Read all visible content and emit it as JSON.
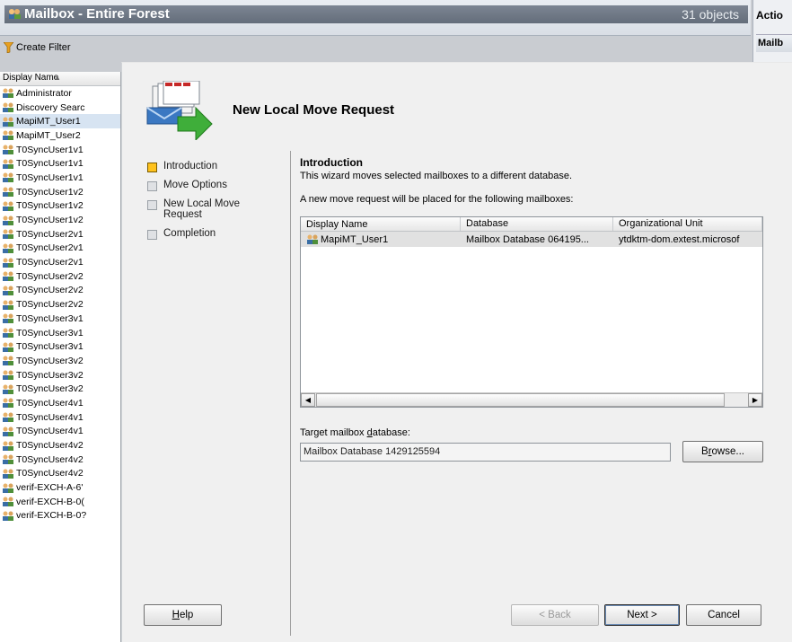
{
  "console": {
    "title": "Mailbox - Entire Forest",
    "object_count": "31 objects",
    "create_filter": "Create Filter",
    "actions_title": "Actio",
    "actions_section": "Mailb"
  },
  "list": {
    "column_header": "Display Name",
    "rows": [
      "Administrator",
      "Discovery Searc",
      "MapiMT_User1",
      "MapiMT_User2",
      "T0SyncUser1v1",
      "T0SyncUser1v1",
      "T0SyncUser1v1",
      "T0SyncUser1v2",
      "T0SyncUser1v2",
      "T0SyncUser1v2",
      "T0SyncUser2v1",
      "T0SyncUser2v1",
      "T0SyncUser2v1",
      "T0SyncUser2v2",
      "T0SyncUser2v2",
      "T0SyncUser2v2",
      "T0SyncUser3v1",
      "T0SyncUser3v1",
      "T0SyncUser3v1",
      "T0SyncUser3v2",
      "T0SyncUser3v2",
      "T0SyncUser3v2",
      "T0SyncUser4v1",
      "T0SyncUser4v1",
      "T0SyncUser4v1",
      "T0SyncUser4v2",
      "T0SyncUser4v2",
      "T0SyncUser4v2",
      "verif-EXCH-A-6'",
      "verif-EXCH-B-0(",
      "verif-EXCH-B-0?"
    ],
    "selected_index": 2
  },
  "wizard": {
    "title": "New Local Move Request",
    "steps": [
      "Introduction",
      "Move Options",
      "New Local Move Request",
      "Completion"
    ],
    "active_step": 0,
    "heading": "Introduction",
    "description": "This wizard moves selected mailboxes to a different database.",
    "list_label": "A new move request will be placed for the following mailboxes:",
    "grid": {
      "columns": [
        "Display Name",
        "Database",
        "Organizational Unit"
      ],
      "rows": [
        [
          "MapiMT_User1",
          "Mailbox Database 064195...",
          "ytdktm-dom.extest.microsof"
        ]
      ]
    },
    "target_label": "Target mailbox database:",
    "target_value": "Mailbox Database 1429125594",
    "buttons": {
      "browse": "Browse...",
      "help": "Help",
      "back": "< Back",
      "next": "Next >",
      "cancel": "Cancel"
    }
  }
}
